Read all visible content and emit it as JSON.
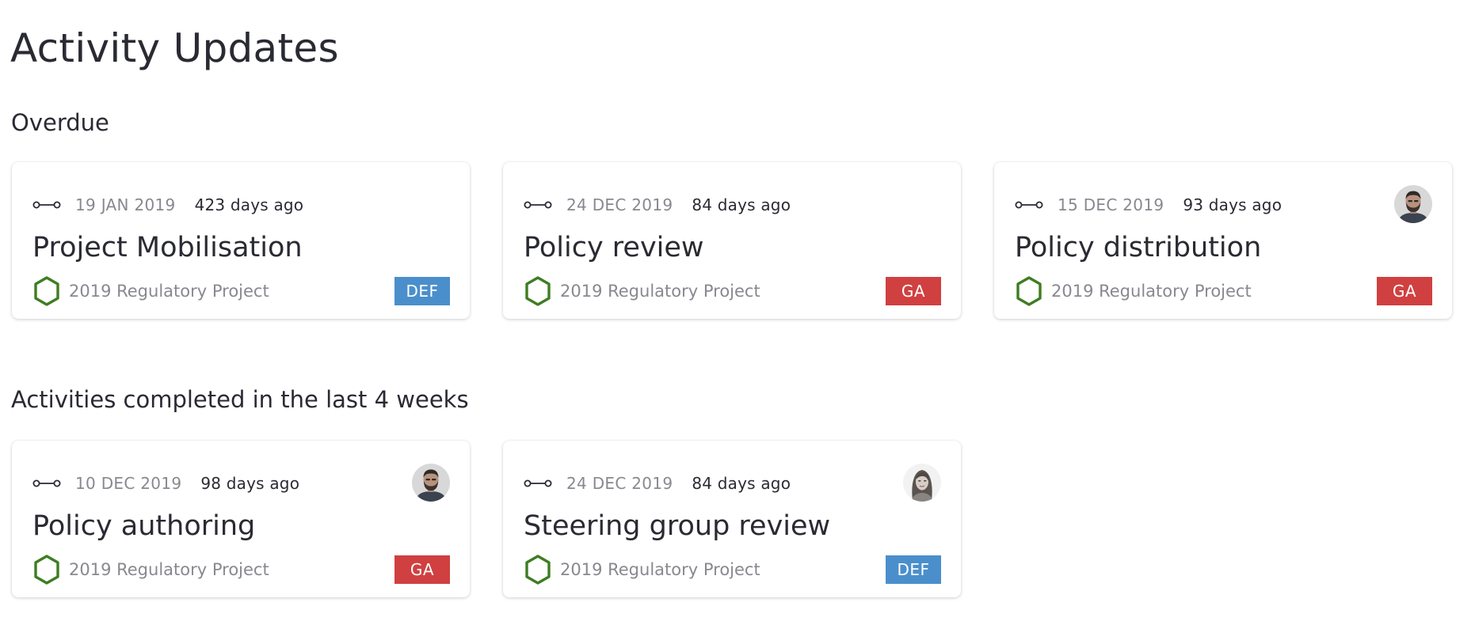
{
  "page": {
    "title": "Activity Updates"
  },
  "colors": {
    "tag_def": "#4a8fcc",
    "tag_ga": "#d04040",
    "hexagon": "#3e7d22",
    "muted_text": "#888890",
    "text": "#2a2a33"
  },
  "sections": [
    {
      "heading": "Overdue",
      "cards": [
        {
          "date": "19 JAN 2019",
          "ago": "423 days ago",
          "title": "Project Mobilisation",
          "project": "2019 Regulatory Project",
          "tag": "DEF",
          "avatar": null
        },
        {
          "date": "24 DEC 2019",
          "ago": "84 days ago",
          "title": "Policy review",
          "project": "2019 Regulatory Project",
          "tag": "GA",
          "avatar": null
        },
        {
          "date": "15 DEC 2019",
          "ago": "93 days ago",
          "title": "Policy distribution",
          "project": "2019 Regulatory Project",
          "tag": "GA",
          "avatar": "man-avatar"
        }
      ]
    },
    {
      "heading": "Activities completed in the last 4 weeks",
      "cards": [
        {
          "date": "10 DEC 2019",
          "ago": "98 days ago",
          "title": "Policy authoring",
          "project": "2019 Regulatory Project",
          "tag": "GA",
          "avatar": "man-avatar"
        },
        {
          "date": "24 DEC 2019",
          "ago": "84 days ago",
          "title": "Steering group review",
          "project": "2019 Regulatory Project",
          "tag": "DEF",
          "avatar": "woman-avatar"
        }
      ]
    }
  ]
}
